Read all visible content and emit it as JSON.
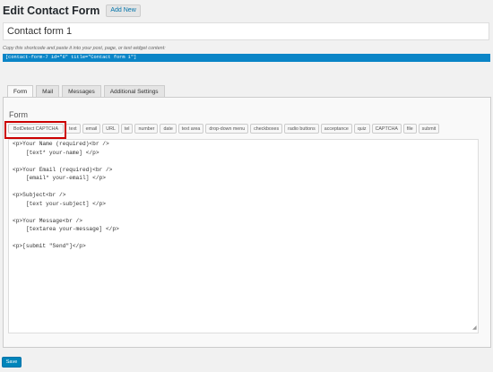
{
  "header": {
    "title": "Edit Contact Form",
    "add_new_label": "Add New"
  },
  "form_name": {
    "value": "Contact form 1"
  },
  "shortcode": {
    "hint": "Copy this shortcode and paste it into your post, page, or text widget content:",
    "code": "[contact-form-7 id=\"6\" title=\"Contact form 1\"]"
  },
  "tabs": [
    {
      "label": "Form",
      "active": true
    },
    {
      "label": "Mail",
      "active": false
    },
    {
      "label": "Messages",
      "active": false
    },
    {
      "label": "Additional Settings",
      "active": false
    }
  ],
  "panel": {
    "heading": "Form",
    "tag_buttons": [
      "BotDetect CAPTCHA",
      "text",
      "email",
      "URL",
      "tel",
      "number",
      "date",
      "text area",
      "drop-down menu",
      "checkboxes",
      "radio buttons",
      "acceptance",
      "quiz",
      "CAPTCHA",
      "file",
      "submit"
    ],
    "highlighted_button": "BotDetect CAPTCHA",
    "highlight_color": "#cc0000",
    "editor_content": "<p>Your Name (required)<br />\n    [text* your-name] </p>\n\n<p>Your Email (required)<br />\n    [email* your-email] </p>\n\n<p>Subject<br />\n    [text your-subject] </p>\n\n<p>Your Message<br />\n    [textarea your-message] </p>\n\n<p>[submit \"Send\"]</p>"
  },
  "footer": {
    "save_label": "Save"
  },
  "colors": {
    "primary": "#0085ba",
    "shortcode_bar": "#0a85c7",
    "background": "#f1f1f1"
  }
}
